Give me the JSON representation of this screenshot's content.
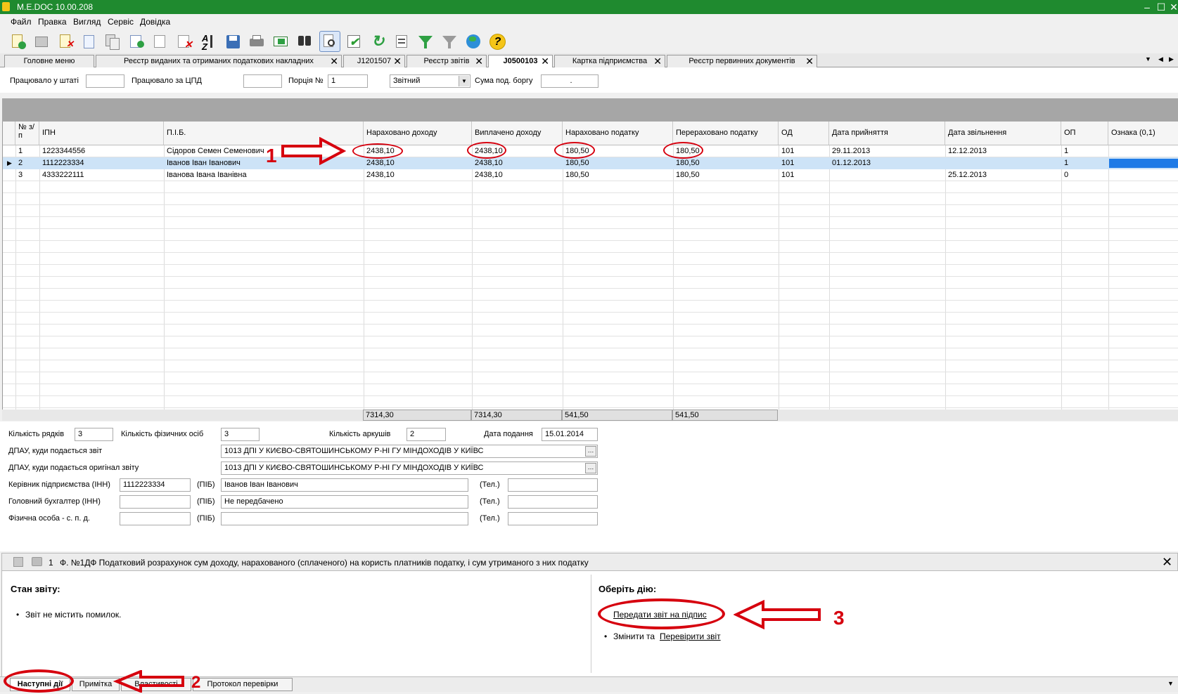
{
  "window": {
    "title": "M.E.DOC 10.00.208"
  },
  "menu": {
    "items": [
      "Файл",
      "Правка",
      "Вигляд",
      "Сервіс",
      "Довідка"
    ]
  },
  "toolbar": {
    "icons": [
      "new-doc-icon",
      "open-icon",
      "delete-doc-icon",
      "copy-icon",
      "copy2-icon",
      "add-row-icon",
      "edit-row-icon",
      "delete-row-icon",
      "sort-icon",
      "save-icon",
      "print-icon",
      "send-icon",
      "find-icon",
      "preview-icon",
      "check-icon",
      "refresh-icon",
      "list-icon",
      "filter-icon",
      "clear-filter-icon",
      "globe-icon",
      "help-icon"
    ]
  },
  "tabs": [
    {
      "label": "Головне меню",
      "closable": false
    },
    {
      "label": "Реєстр виданих та отриманих податкових накладних",
      "closable": true
    },
    {
      "label": "J1201507",
      "closable": true
    },
    {
      "label": "Реєстр звітів",
      "closable": true
    },
    {
      "label": "J0500103",
      "closable": true,
      "active": true
    },
    {
      "label": "Картка підприємства",
      "closable": true
    },
    {
      "label": "Реєстр первинних документів",
      "closable": true
    }
  ],
  "filter": {
    "worked_staff_label": "Працювало у штаті",
    "worked_staff_value": "",
    "worked_cpd_label": "Працювало за ЦПД",
    "worked_cpd_value": "",
    "portion_label": "Порція №",
    "portion_value": "1",
    "report_type_value": "Звітний",
    "debt_label": "Сума под. боргу",
    "debt_value": "."
  },
  "grid": {
    "columns": [
      "№ з/п",
      "ІПН",
      "П.І.Б.",
      "Нараховано доходу",
      "Виплачено доходу",
      "Нараховано податку",
      "Перераховано податку",
      "ОД",
      "Дата прийняття",
      "Дата звільнення",
      "ОП",
      "Ознака (0,1)"
    ],
    "rows": [
      [
        "1",
        "1223344556",
        "Сідоров Семен Семенович",
        "2438,10",
        "2438,10",
        "180,50",
        "180,50",
        "101",
        "29.11.2013",
        "12.12.2013",
        "1",
        ""
      ],
      [
        "2",
        "1112223334",
        "Іванов Іван Іванович",
        "2438,10",
        "2438,10",
        "180,50",
        "180,50",
        "101",
        "01.12.2013",
        "",
        "1",
        ""
      ],
      [
        "3",
        "4333222111",
        "Іванова Івана Іванівна",
        "2438,10",
        "2438,10",
        "180,50",
        "180,50",
        "101",
        "",
        "25.12.2013",
        "0",
        ""
      ]
    ],
    "totals": [
      "7314,30",
      "7314,30",
      "541,50",
      "541,50"
    ]
  },
  "form": {
    "rows_count_label": "Кількість рядків",
    "rows_count": "3",
    "persons_label": "Кількість фізичних осіб",
    "persons": "3",
    "sheets_label": "Кількість аркушів",
    "sheets": "2",
    "submit_date_label": "Дата подання",
    "submit_date": "15.01.2014",
    "dpau_label": "ДПАУ, куди подається звіт",
    "dpau_value": "1013 ДПІ У КИЄВО-СВЯТОШИНСЬКОМУ Р-НІ  ГУ МІНДОХОДІВ У КИЇВС",
    "dpau_orig_label": "ДПАУ, куди подається оригінал звіту",
    "dpau_orig_value": "1013 ДПІ У КИЄВО-СВЯТОШИНСЬКОМУ Р-НІ  ГУ МІНДОХОДІВ У КИЇВС",
    "director_label": "Керівник підприємства (ІНН)",
    "director_inn": "1112223334",
    "director_name": "Іванов Іван Іванович",
    "director_phone": "",
    "accountant_label": "Головний бухгалтер (ІНН)",
    "accountant_inn": "",
    "accountant_name": "Не передбачено",
    "accountant_phone": "",
    "person_label": "Фізична особа - с. п. д.",
    "person_inn": "",
    "person_name": "",
    "person_phone": "",
    "pib_label": "(ПІБ)",
    "tel_label": "(Тел.)"
  },
  "docbar": {
    "num": "1",
    "title": "Ф. №1ДФ Податковий розрахунок сум доходу, нарахованого (сплаченого) на користь платників податку, і сум утриманого з них податку"
  },
  "panel": {
    "status_title": "Стан звіту:",
    "status_item": "Звіт не містить помилок.",
    "action_title": "Оберіть дію:",
    "action_link": "Передати звіт на підпис",
    "change_prefix": "Змінити та",
    "change_link": "Перевірити звіт"
  },
  "bottom_tabs": [
    "Наступні дії",
    "Примітка",
    "Властивості",
    "Протокол перевірки"
  ],
  "annotations": {
    "n1": "1",
    "n2": "2",
    "n3": "3"
  },
  "colors": {
    "title_green": "#1f8a2f",
    "annotation_red": "#d6000e",
    "selection": "#cde3f7",
    "indicator_blue": "#1e7ae6"
  }
}
